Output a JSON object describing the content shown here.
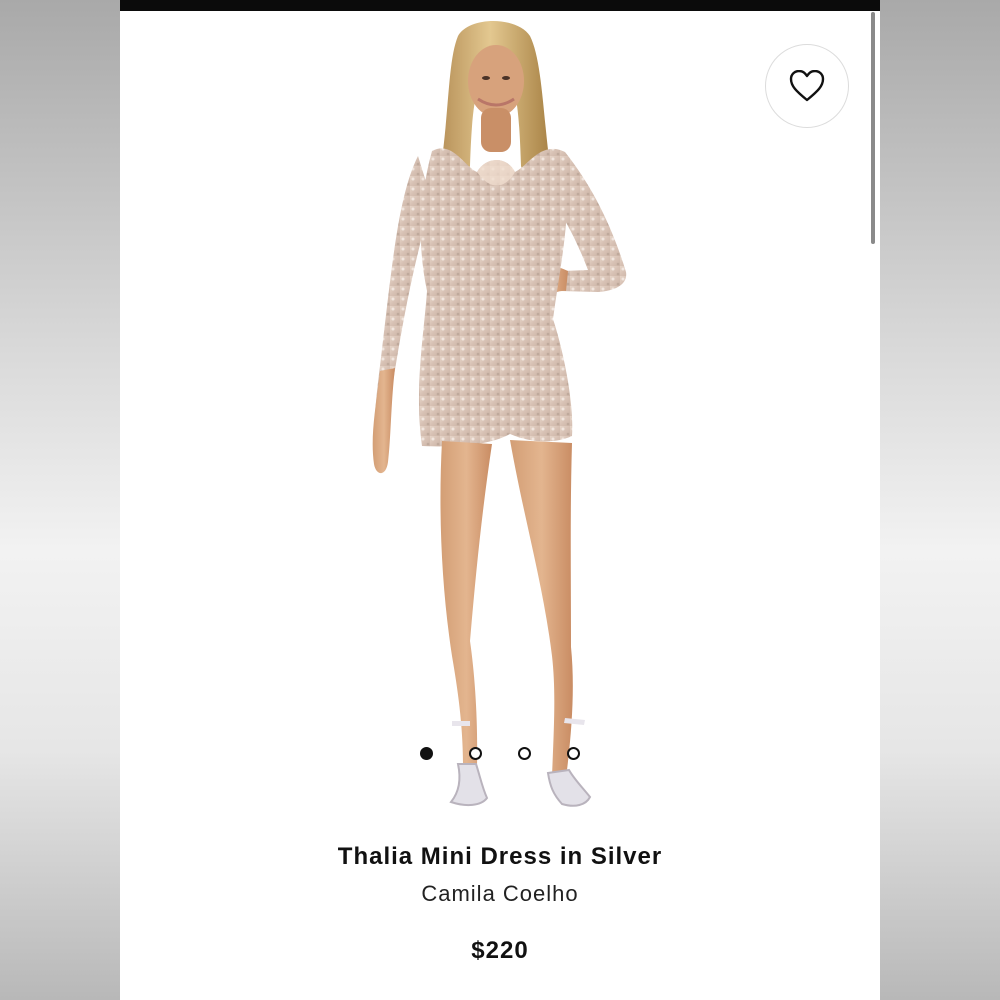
{
  "product": {
    "name": "Thalia Mini Dress in Silver",
    "brand": "Camila Coelho",
    "price": "$220"
  },
  "gallery": {
    "active_index": 0,
    "slides": 4
  },
  "icons": {
    "favorite": "heart-icon"
  },
  "colors": {
    "text": "#111111",
    "background": "#ffffff",
    "top_bar": "#0b0b0b"
  }
}
